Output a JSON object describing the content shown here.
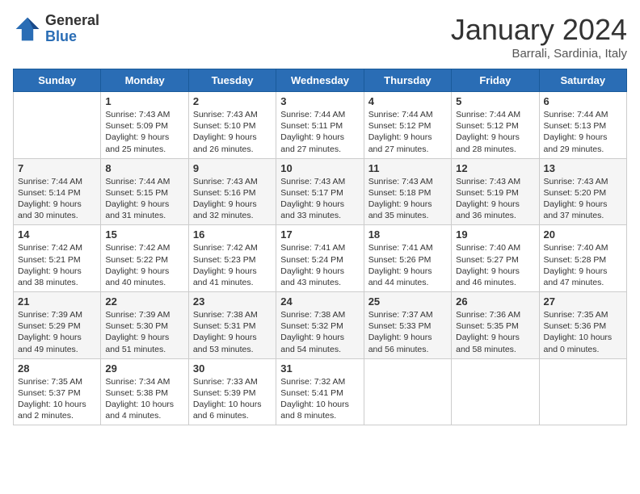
{
  "header": {
    "logo_general": "General",
    "logo_blue": "Blue",
    "month_title": "January 2024",
    "location": "Barrali, Sardinia, Italy"
  },
  "weekdays": [
    "Sunday",
    "Monday",
    "Tuesday",
    "Wednesday",
    "Thursday",
    "Friday",
    "Saturday"
  ],
  "weeks": [
    [
      null,
      {
        "day": 1,
        "sunrise": "7:43 AM",
        "sunset": "5:09 PM",
        "daylight": "9 hours and 25 minutes."
      },
      {
        "day": 2,
        "sunrise": "7:43 AM",
        "sunset": "5:10 PM",
        "daylight": "9 hours and 26 minutes."
      },
      {
        "day": 3,
        "sunrise": "7:44 AM",
        "sunset": "5:11 PM",
        "daylight": "9 hours and 27 minutes."
      },
      {
        "day": 4,
        "sunrise": "7:44 AM",
        "sunset": "5:12 PM",
        "daylight": "9 hours and 27 minutes."
      },
      {
        "day": 5,
        "sunrise": "7:44 AM",
        "sunset": "5:12 PM",
        "daylight": "9 hours and 28 minutes."
      },
      {
        "day": 6,
        "sunrise": "7:44 AM",
        "sunset": "5:13 PM",
        "daylight": "9 hours and 29 minutes."
      }
    ],
    [
      {
        "day": 7,
        "sunrise": "7:44 AM",
        "sunset": "5:14 PM",
        "daylight": "9 hours and 30 minutes."
      },
      {
        "day": 8,
        "sunrise": "7:44 AM",
        "sunset": "5:15 PM",
        "daylight": "9 hours and 31 minutes."
      },
      {
        "day": 9,
        "sunrise": "7:43 AM",
        "sunset": "5:16 PM",
        "daylight": "9 hours and 32 minutes."
      },
      {
        "day": 10,
        "sunrise": "7:43 AM",
        "sunset": "5:17 PM",
        "daylight": "9 hours and 33 minutes."
      },
      {
        "day": 11,
        "sunrise": "7:43 AM",
        "sunset": "5:18 PM",
        "daylight": "9 hours and 35 minutes."
      },
      {
        "day": 12,
        "sunrise": "7:43 AM",
        "sunset": "5:19 PM",
        "daylight": "9 hours and 36 minutes."
      },
      {
        "day": 13,
        "sunrise": "7:43 AM",
        "sunset": "5:20 PM",
        "daylight": "9 hours and 37 minutes."
      }
    ],
    [
      {
        "day": 14,
        "sunrise": "7:42 AM",
        "sunset": "5:21 PM",
        "daylight": "9 hours and 38 minutes."
      },
      {
        "day": 15,
        "sunrise": "7:42 AM",
        "sunset": "5:22 PM",
        "daylight": "9 hours and 40 minutes."
      },
      {
        "day": 16,
        "sunrise": "7:42 AM",
        "sunset": "5:23 PM",
        "daylight": "9 hours and 41 minutes."
      },
      {
        "day": 17,
        "sunrise": "7:41 AM",
        "sunset": "5:24 PM",
        "daylight": "9 hours and 43 minutes."
      },
      {
        "day": 18,
        "sunrise": "7:41 AM",
        "sunset": "5:26 PM",
        "daylight": "9 hours and 44 minutes."
      },
      {
        "day": 19,
        "sunrise": "7:40 AM",
        "sunset": "5:27 PM",
        "daylight": "9 hours and 46 minutes."
      },
      {
        "day": 20,
        "sunrise": "7:40 AM",
        "sunset": "5:28 PM",
        "daylight": "9 hours and 47 minutes."
      }
    ],
    [
      {
        "day": 21,
        "sunrise": "7:39 AM",
        "sunset": "5:29 PM",
        "daylight": "9 hours and 49 minutes."
      },
      {
        "day": 22,
        "sunrise": "7:39 AM",
        "sunset": "5:30 PM",
        "daylight": "9 hours and 51 minutes."
      },
      {
        "day": 23,
        "sunrise": "7:38 AM",
        "sunset": "5:31 PM",
        "daylight": "9 hours and 53 minutes."
      },
      {
        "day": 24,
        "sunrise": "7:38 AM",
        "sunset": "5:32 PM",
        "daylight": "9 hours and 54 minutes."
      },
      {
        "day": 25,
        "sunrise": "7:37 AM",
        "sunset": "5:33 PM",
        "daylight": "9 hours and 56 minutes."
      },
      {
        "day": 26,
        "sunrise": "7:36 AM",
        "sunset": "5:35 PM",
        "daylight": "9 hours and 58 minutes."
      },
      {
        "day": 27,
        "sunrise": "7:35 AM",
        "sunset": "5:36 PM",
        "daylight": "10 hours and 0 minutes."
      }
    ],
    [
      {
        "day": 28,
        "sunrise": "7:35 AM",
        "sunset": "5:37 PM",
        "daylight": "10 hours and 2 minutes."
      },
      {
        "day": 29,
        "sunrise": "7:34 AM",
        "sunset": "5:38 PM",
        "daylight": "10 hours and 4 minutes."
      },
      {
        "day": 30,
        "sunrise": "7:33 AM",
        "sunset": "5:39 PM",
        "daylight": "10 hours and 6 minutes."
      },
      {
        "day": 31,
        "sunrise": "7:32 AM",
        "sunset": "5:41 PM",
        "daylight": "10 hours and 8 minutes."
      },
      null,
      null,
      null
    ]
  ]
}
